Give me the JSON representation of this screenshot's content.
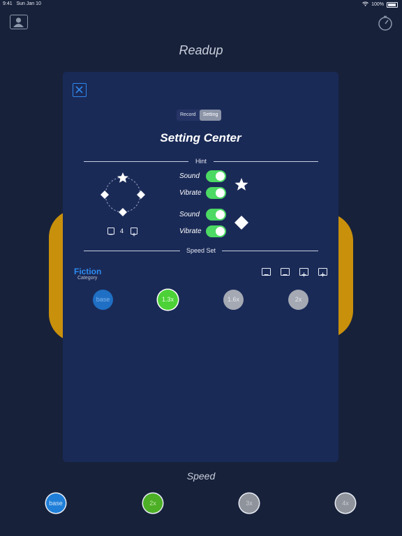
{
  "status_bar": {
    "time": "9:41",
    "date": "Sun Jan 10",
    "battery": "100%"
  },
  "app": {
    "title": "Readup",
    "speed_label": "Speed"
  },
  "panel": {
    "tabs": [
      {
        "label": "Record",
        "active": false
      },
      {
        "label": "Setting",
        "active": true
      }
    ],
    "title": "Setting Center",
    "hint_label": "Hint",
    "speed_set_label": "Speed Set",
    "counter_value": "4",
    "star_group": {
      "sound_label": "Sound",
      "vibrate_label": "Vibrate",
      "sound_on": true,
      "vibrate_on": true
    },
    "diamond_group": {
      "sound_label": "Sound",
      "vibrate_label": "Vibrate",
      "sound_on": true,
      "vibrate_on": true
    },
    "category_name": "Fiction",
    "category_caption": "Category",
    "speeds": [
      {
        "label": "base",
        "color": "#1f6fc4",
        "text_color": "#7fb3ec"
      },
      {
        "label": "1.3x",
        "color": "#4cd137",
        "text_color": "#e6ffe0"
      },
      {
        "label": "1.6x",
        "color": "#a4a9b3",
        "text_color": "#e4e6ea"
      },
      {
        "label": "2x",
        "color": "#a4a9b3",
        "text_color": "#e4e6ea"
      }
    ]
  },
  "bottom_speeds": [
    {
      "label": "base",
      "color": "#1f7fd8",
      "text_color": "#cfe3fb"
    },
    {
      "label": "2x",
      "color": "#4caf25",
      "text_color": "#bfe7a8"
    },
    {
      "label": "3x",
      "color": "#8f949c",
      "text_color": "#c7cbd1"
    },
    {
      "label": "4x",
      "color": "#8f949c",
      "text_color": "#c7cbd1"
    }
  ],
  "colors": {
    "accent": "#2d8cf0",
    "toggle_on": "#4cd964",
    "panel": "#1a2a57",
    "background": "#17213a",
    "gold": "#c9900c"
  }
}
